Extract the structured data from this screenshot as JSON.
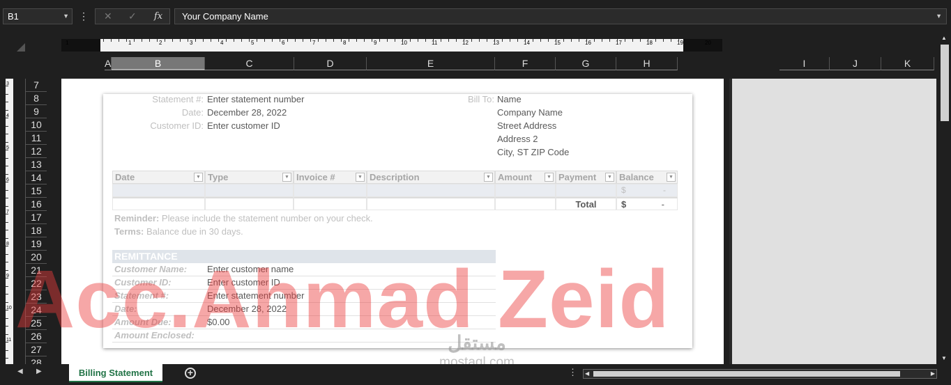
{
  "formula_bar": {
    "name_box": "B1",
    "content": "Your Company Name"
  },
  "ruler": {
    "numbers": [
      "1",
      "1",
      "2",
      "3",
      "4",
      "5",
      "6",
      "7",
      "8",
      "9",
      "10",
      "11",
      "12",
      "13",
      "14",
      "15",
      "16",
      "17",
      "18",
      "19",
      "20"
    ],
    "vnumbers": [
      "3",
      "4",
      "5",
      "6",
      "7",
      "8",
      "9",
      "10",
      "11"
    ]
  },
  "columns": [
    "A",
    "B",
    "C",
    "D",
    "E",
    "F",
    "G",
    "H",
    "I",
    "J",
    "K"
  ],
  "rows": [
    "7",
    "8",
    "9",
    "10",
    "11",
    "12",
    "13",
    "14",
    "15",
    "16",
    "17",
    "18",
    "19",
    "20",
    "21",
    "22",
    "23",
    "24",
    "25",
    "26",
    "27",
    "28"
  ],
  "statement": {
    "statement_no_label": "Statement #:",
    "statement_no_value": "Enter statement number",
    "date_label": "Date:",
    "date_value": "December 28, 2022",
    "customer_id_label": "Customer ID:",
    "customer_id_value": "Enter customer ID",
    "bill_to_label": "Bill To:",
    "bill_to": [
      "Name",
      "Company Name",
      "Street Address",
      "Address 2",
      "City, ST  ZIP Code"
    ]
  },
  "table": {
    "headers": [
      "Date",
      "Type",
      "Invoice #",
      "Description",
      "Amount",
      "Payment",
      "Balance"
    ],
    "balance_currency": "$",
    "balance_value": "-",
    "total_label": "Total",
    "total_currency": "$",
    "total_value": "-"
  },
  "notes": {
    "reminder_label": "Reminder:",
    "reminder_text": "Please include the statement number on your check.",
    "terms_label": "Terms:",
    "terms_text": "Balance due in 30 days."
  },
  "remittance": {
    "title": "REMITTANCE",
    "rows": [
      {
        "label": "Customer Name:",
        "value": "Enter customer name"
      },
      {
        "label": "Customer ID:",
        "value": "Enter customer ID"
      },
      {
        "label": "Statement #:",
        "value": "Enter statement number"
      },
      {
        "label": "Date:",
        "value": "December 28, 2022"
      },
      {
        "label": "Amount Due:",
        "value": "$0.00"
      },
      {
        "label": "Amount Enclosed:",
        "value": ""
      }
    ]
  },
  "watermark": {
    "text": "Acc.Ahmad Zeid",
    "logo_ar": "مستقل",
    "logo_en": "mostaql.com"
  },
  "sheet_tab": "Billing Statement",
  "colors": {
    "accent": "#217346",
    "watermark": "#eb3c3c"
  }
}
